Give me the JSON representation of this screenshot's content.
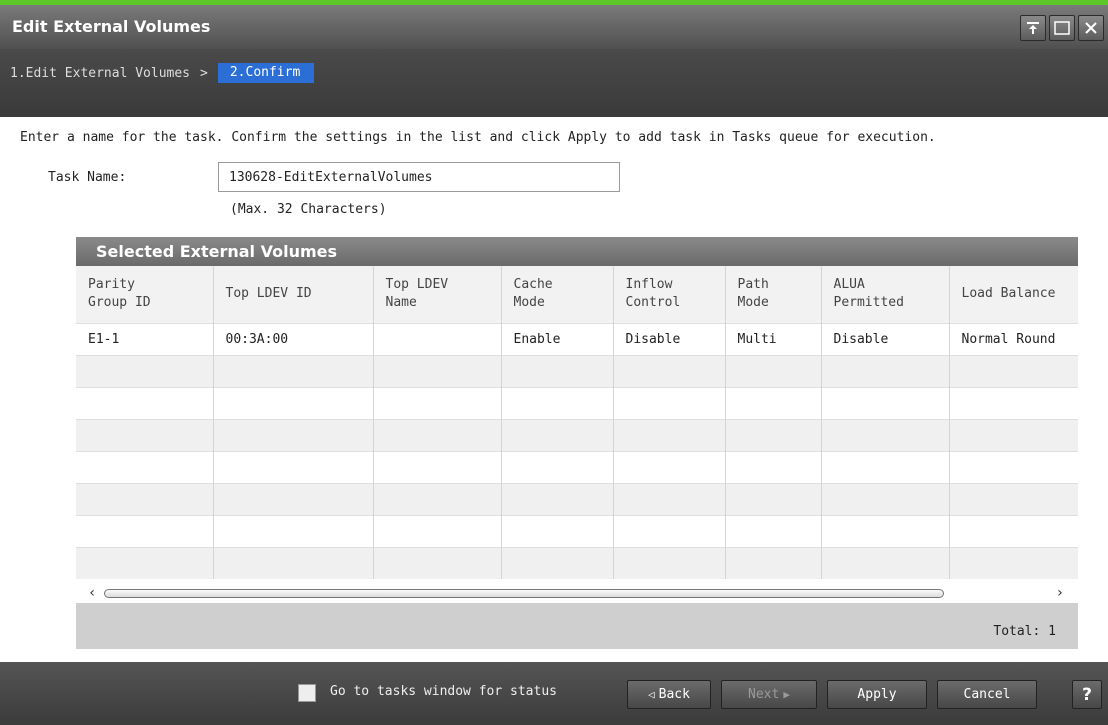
{
  "window": {
    "title": "Edit External Volumes",
    "controls": [
      "pin-icon",
      "maximize-icon",
      "close-icon"
    ]
  },
  "wizard": {
    "step1": "1.Edit External Volumes",
    "separator": ">",
    "step2": "2.Confirm"
  },
  "instruction": "Enter a name for the task. Confirm the settings in the list and click Apply to add task in Tasks queue for execution.",
  "task": {
    "label": "Task Name:",
    "value": "130628-EditExternalVolumes",
    "hint": "(Max. 32 Characters)"
  },
  "panel": {
    "title": "Selected External Volumes",
    "columns": [
      [
        "Parity",
        "Group ID"
      ],
      [
        "Top LDEV ID"
      ],
      [
        "Top LDEV",
        "Name"
      ],
      [
        "Cache",
        "Mode"
      ],
      [
        "Inflow",
        "Control"
      ],
      [
        "Path",
        "Mode"
      ],
      [
        "ALUA",
        "Permitted"
      ],
      [
        "Load Balance"
      ]
    ],
    "rows": [
      [
        "E1-1",
        "00:3A:00",
        "",
        "Enable",
        "Disable",
        "Multi",
        "Disable",
        "Normal Round"
      ]
    ],
    "total_label": "Total:",
    "total_value": "1"
  },
  "footer": {
    "checkbox_label": "Go to tasks window for status",
    "back": "Back",
    "next": "Next",
    "apply": "Apply",
    "cancel": "Cancel",
    "help": "?"
  },
  "colors": {
    "accent_green": "#5dc72a",
    "active_step": "#2b6fd6"
  }
}
